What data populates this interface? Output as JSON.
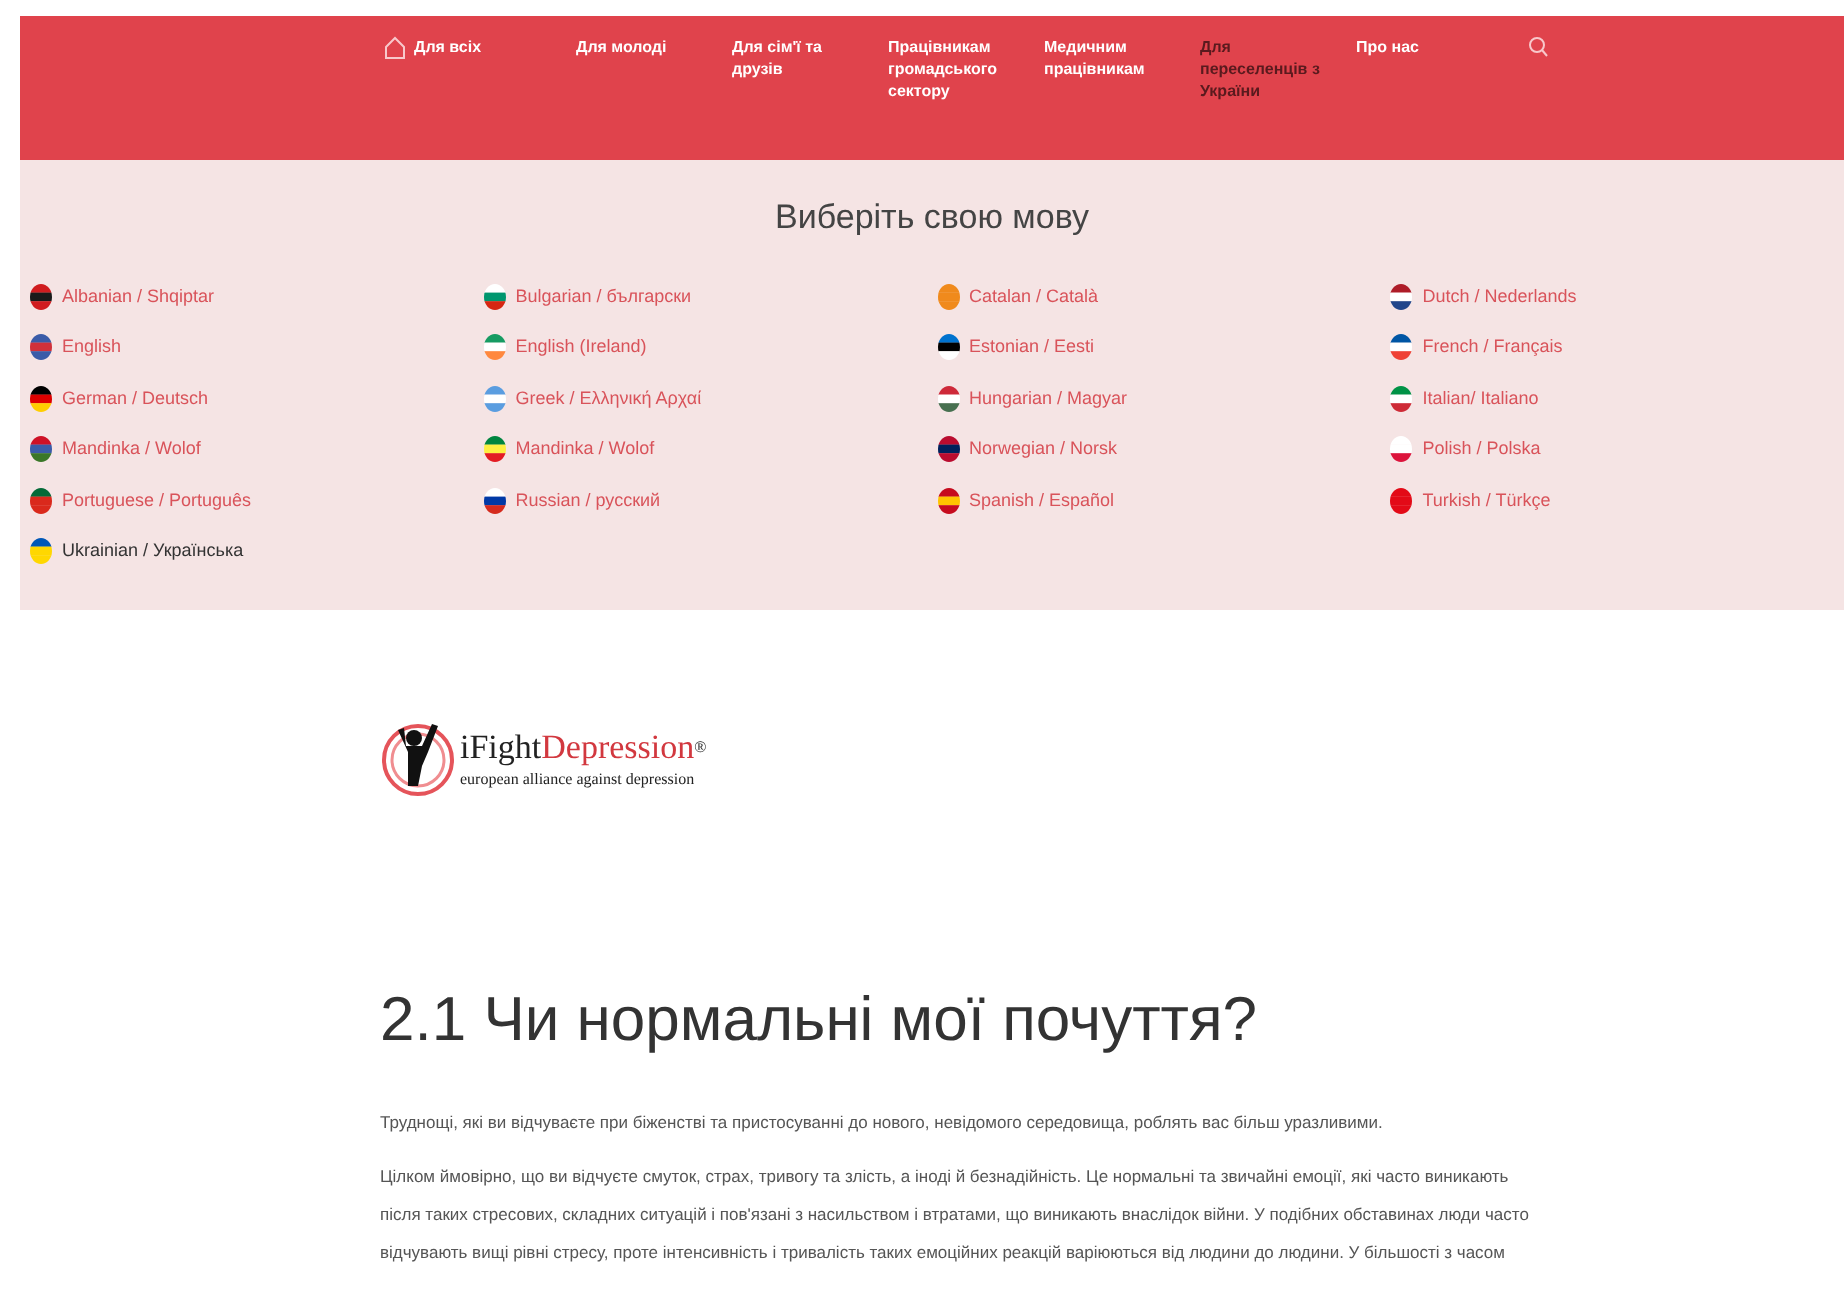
{
  "nav": [
    {
      "kind": "home",
      "label": "Для всіх",
      "selected": false
    },
    {
      "kind": "link",
      "label": "Для молоді",
      "selected": false
    },
    {
      "kind": "link",
      "label": "Для сім'ї та друзів",
      "selected": false
    },
    {
      "kind": "link",
      "label": "Працівникам громадського сектору",
      "selected": false
    },
    {
      "kind": "link",
      "label": "Медичним працівникам",
      "selected": false
    },
    {
      "kind": "link",
      "label": "Для переселенців з України",
      "selected": true
    },
    {
      "kind": "link",
      "label": "Про нас",
      "selected": false
    }
  ],
  "language_picker": {
    "title": "Виберіть свою мову",
    "languages": [
      {
        "label": "Albanian / Shqiptar",
        "selected": false,
        "kind": "albania"
      },
      {
        "label": "Bulgarian / български",
        "selected": false,
        "kind": "bulgaria"
      },
      {
        "label": "Catalan / Català",
        "selected": false,
        "kind": "catalonia"
      },
      {
        "label": "Dutch / Nederlands",
        "selected": false,
        "kind": "netherlands"
      },
      {
        "label": "English",
        "selected": false,
        "kind": "uk"
      },
      {
        "label": "English (Ireland)",
        "selected": false,
        "kind": "ireland"
      },
      {
        "label": "Estonian / Eesti",
        "selected": false,
        "kind": "estonia"
      },
      {
        "label": "French / Français",
        "selected": false,
        "kind": "france"
      },
      {
        "label": "German / Deutsch",
        "selected": false,
        "kind": "germany"
      },
      {
        "label": "Greek / Ελληνική Αρχαί",
        "selected": false,
        "kind": "greece"
      },
      {
        "label": "Hungarian / Magyar",
        "selected": false,
        "kind": "hungary"
      },
      {
        "label": "Italian/ Italiano",
        "selected": false,
        "kind": "italy"
      },
      {
        "label": "Mandinka / Wolof",
        "selected": false,
        "kind": "gambia"
      },
      {
        "label": "Mandinka / Wolof",
        "selected": false,
        "kind": "senegal"
      },
      {
        "label": "Norwegian / Norsk",
        "selected": false,
        "kind": "norway"
      },
      {
        "label": "Polish / Polska",
        "selected": false,
        "kind": "poland"
      },
      {
        "label": "Portuguese / Português",
        "selected": false,
        "kind": "portugal"
      },
      {
        "label": "Russian / русский",
        "selected": false,
        "kind": "russia"
      },
      {
        "label": "Spanish / Español",
        "selected": false,
        "kind": "spain"
      },
      {
        "label": "Turkish / Türkçe",
        "selected": false,
        "kind": "turkey"
      },
      {
        "label": "Ukrainian / Українська",
        "selected": true,
        "kind": "ukraine"
      }
    ]
  },
  "logo": {
    "name_prefix": "iFight",
    "name_main": "Depression",
    "mark": "®",
    "tagline": "european alliance against depression"
  },
  "article": {
    "heading": "2.1 Чи нормальні мої почуття?",
    "paragraphs": [
      "Труднощі, які ви відчуваєте при біженстві та пристосуванні до нового, невідомого середовища, роблять вас більш уразливими.",
      "Цілком ймовірно, що ви відчуєте смуток, страх, тривогу та злість, а іноді й безнадійність. Це нормальні та звичайні емоції, які часто виникають після таких стресових, складних ситуацій і пов'язані з насильством і втратами, що виникають внаслідок війни. У подібних обставинах люди часто відчувають вищі рівні стресу, проте інтенсивність і тривалість таких емоційних реакцій варіюються від людини до людини. У більшості з часом"
    ]
  }
}
